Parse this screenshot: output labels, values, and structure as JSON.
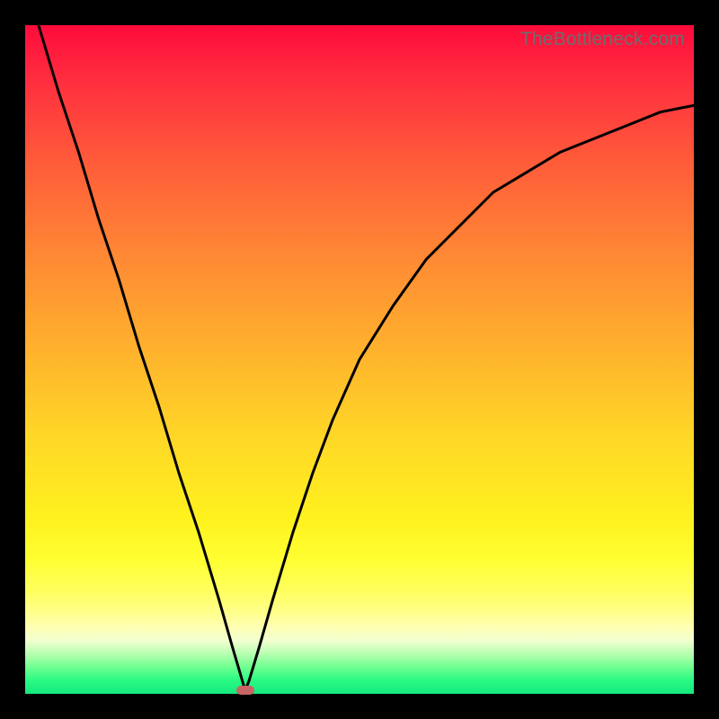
{
  "watermark": "TheBottleneck.com",
  "colors": {
    "background": "#000000",
    "curve": "#000000",
    "marker": "#c86464"
  },
  "chart_data": {
    "type": "line",
    "title": "",
    "xlabel": "",
    "ylabel": "",
    "xlim": [
      0,
      100
    ],
    "ylim": [
      0,
      100
    ],
    "legend": false,
    "annotations": [
      "TheBottleneck.com"
    ],
    "series": [
      {
        "name": "curve",
        "x": [
          2,
          5,
          8,
          11,
          14,
          17,
          20,
          23,
          26,
          29,
          31,
          32.9,
          33.5,
          35,
          37,
          40,
          43,
          46,
          50,
          55,
          60,
          65,
          70,
          75,
          80,
          85,
          90,
          95,
          100
        ],
        "y": [
          100,
          90,
          81,
          71,
          62,
          52,
          43,
          33,
          24,
          14,
          7,
          0.5,
          2,
          7,
          14,
          24,
          33,
          41,
          50,
          58,
          65,
          70,
          75,
          78,
          81,
          83,
          85,
          87,
          88
        ]
      }
    ],
    "marker": {
      "x": 32.9,
      "y": 0.5
    }
  }
}
